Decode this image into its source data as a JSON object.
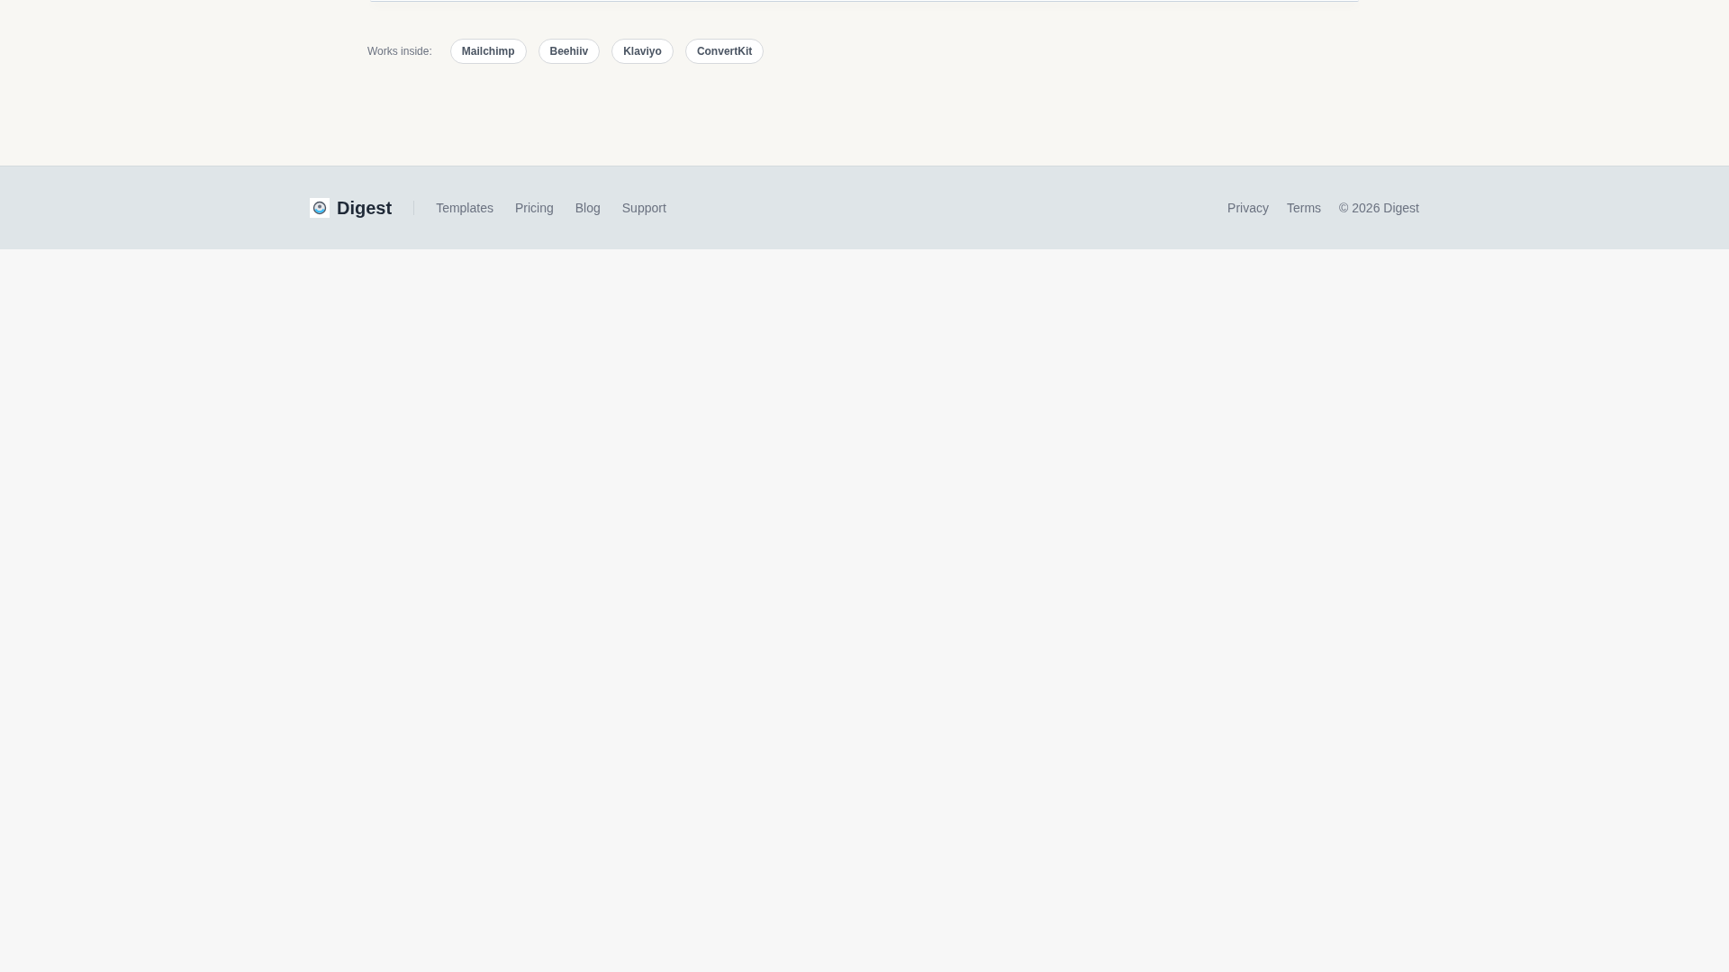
{
  "integrations": {
    "label": "Works inside:",
    "chips": [
      "Mailchimp",
      "Beehiiv",
      "Klaviyo",
      "ConvertKit"
    ]
  },
  "footer": {
    "brand": "Digest",
    "links": [
      "Templates",
      "Pricing",
      "Blog",
      "Support"
    ],
    "legal_links": [
      "Privacy",
      "Terms"
    ],
    "copyright": "© 2026 Digest"
  }
}
